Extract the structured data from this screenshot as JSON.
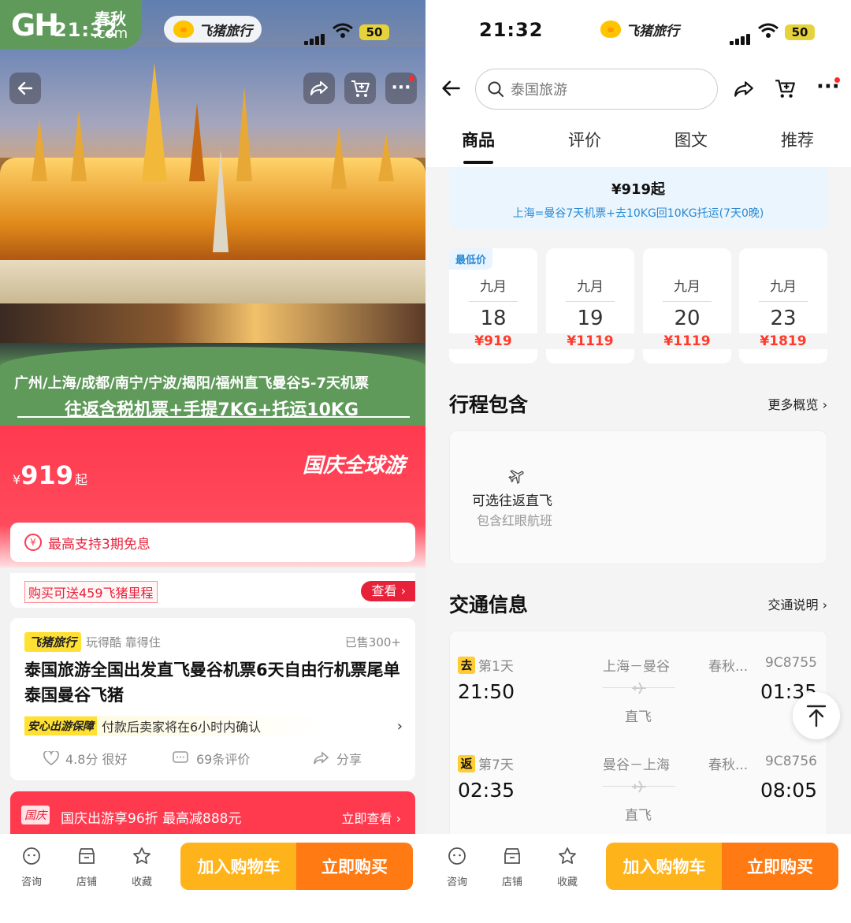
{
  "status_left": {
    "time": "21:32",
    "battery": "50",
    "brand": "飞猪旅行"
  },
  "status_right": {
    "time": "21:32",
    "battery": "50",
    "brand": "飞猪旅行"
  },
  "watermark": {
    "logo": "GH",
    "cn": "春秋",
    "com": ".com"
  },
  "hero": {
    "line1": "广州/上海/成都/南宁/宁波/揭阳/福州直飞曼谷5-7天机票",
    "line2": "往返含税机票+手提7KG+托运10KG"
  },
  "price": {
    "currency": "¥",
    "amount": "919",
    "suffix": "起",
    "campaign": "国庆全球游"
  },
  "installment": {
    "icon_text": "¥",
    "text": "最高支持3期免息"
  },
  "miles": {
    "text": "购买可送459飞猪里程",
    "view": "查看"
  },
  "product": {
    "brand_tag": "飞猪旅行",
    "brand_slogan": "玩得酷 靠得住",
    "sold": "已售300+",
    "title": "泰国旅游全国出发直飞曼谷机票6天自由行机票尾单泰国曼谷飞猪",
    "guarantee_tag": "安心出游保障",
    "guarantee_text": "付款后卖家将在6小时内确认",
    "rating": "4.8分 很好",
    "reviews": "69条评价",
    "share": "分享"
  },
  "promo": {
    "tag": "国庆",
    "text": "国庆出游享96折 最高减888元",
    "link": "立即查看"
  },
  "bottom_bar": {
    "consult": "咨询",
    "store": "店铺",
    "favorite": "收藏",
    "add_cart": "加入购物车",
    "buy_now": "立即购买"
  },
  "search": {
    "placeholder": "泰国旅游"
  },
  "tabs": [
    "商品",
    "评价",
    "图文",
    "推荐"
  ],
  "package": {
    "price": "¥919起",
    "desc": "上海=曼谷7天机票+去10KG回10KG托运(7天0晚)"
  },
  "dates": [
    {
      "month": "九月",
      "day": "18",
      "price": "¥919",
      "badge": "最低价"
    },
    {
      "month": "九月",
      "day": "19",
      "price": "¥1119"
    },
    {
      "month": "九月",
      "day": "20",
      "price": "¥1119"
    },
    {
      "month": "九月",
      "day": "23",
      "price": "¥1819"
    }
  ],
  "itinerary": {
    "title": "行程包含",
    "more": "更多概览",
    "item_title": "可选往返直飞",
    "item_sub": "包含红眼航班"
  },
  "transport": {
    "title": "交通信息",
    "more": "交通说明",
    "outbound": {
      "tag": "去",
      "day": "第1天",
      "route": "上海－曼谷",
      "airline": "春秋...",
      "flight": "9C8755",
      "depart": "21:50",
      "arrive": "01:35",
      "type": "直飞"
    },
    "return": {
      "tag": "返",
      "day": "第7天",
      "route": "曼谷－上海",
      "airline": "春秋...",
      "flight": "9C8756",
      "depart": "02:35",
      "arrive": "08:05",
      "type": "直飞"
    }
  }
}
